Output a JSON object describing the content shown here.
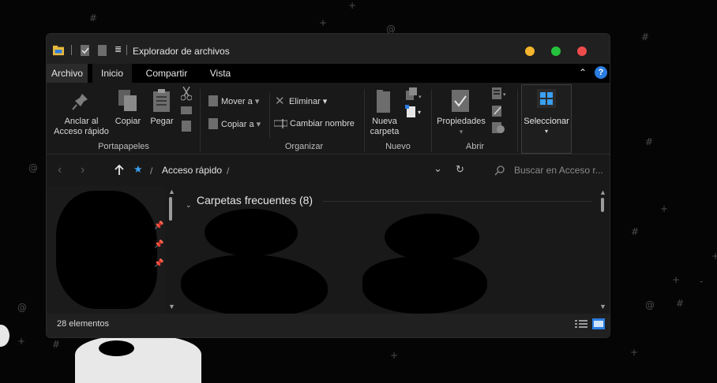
{
  "window": {
    "title": "Explorador de archivos"
  },
  "ribbon_tabs": [
    {
      "label": "Archivo"
    },
    {
      "label": "Inicio"
    },
    {
      "label": "Compartir"
    },
    {
      "label": "Vista"
    }
  ],
  "ribbon": {
    "portapapeles": {
      "group_label": "Portapapeles",
      "pin_label_1": "Anclar al",
      "pin_label_2": "Acceso rápido",
      "copy_label": "Copiar",
      "paste_label": "Pegar"
    },
    "organizar": {
      "group_label": "Organizar",
      "move_label": "Mover a",
      "copy_to_label": "Copiar a",
      "delete_label": "Eliminar",
      "rename_label": "Cambiar nombre"
    },
    "nuevo": {
      "group_label": "Nuevo",
      "new_folder_1": "Nueva",
      "new_folder_2": "carpeta"
    },
    "abrir": {
      "group_label": "Abrir",
      "properties_label": "Propiedades"
    },
    "seleccionar": {
      "label": "Seleccionar"
    }
  },
  "address": {
    "crumb": "Acceso rápido",
    "separator": "/"
  },
  "search": {
    "placeholder": "Buscar en Acceso r..."
  },
  "content": {
    "section_title": "Carpetas frecuentes (8)"
  },
  "status": {
    "item_count": "28 elementos"
  },
  "colors": {
    "traffic_yellow": "#f5b52c",
    "traffic_green": "#26c13d",
    "traffic_red": "#ee4c4c",
    "help_blue": "#2b7de0",
    "star_blue": "#3aa0f2"
  },
  "icons": [
    "folder-icon",
    "checkbox-icon",
    "document-icon",
    "pin-icon",
    "copy-icon",
    "paste-icon",
    "scissors-icon",
    "move-icon",
    "delete-icon",
    "rename-icon",
    "new-folder-icon",
    "new-item-icon",
    "properties-icon",
    "open-icon",
    "select-all-icon",
    "up-arrow-icon",
    "star-icon",
    "refresh-icon",
    "search-icon",
    "details-view-icon",
    "tiles-view-icon"
  ]
}
